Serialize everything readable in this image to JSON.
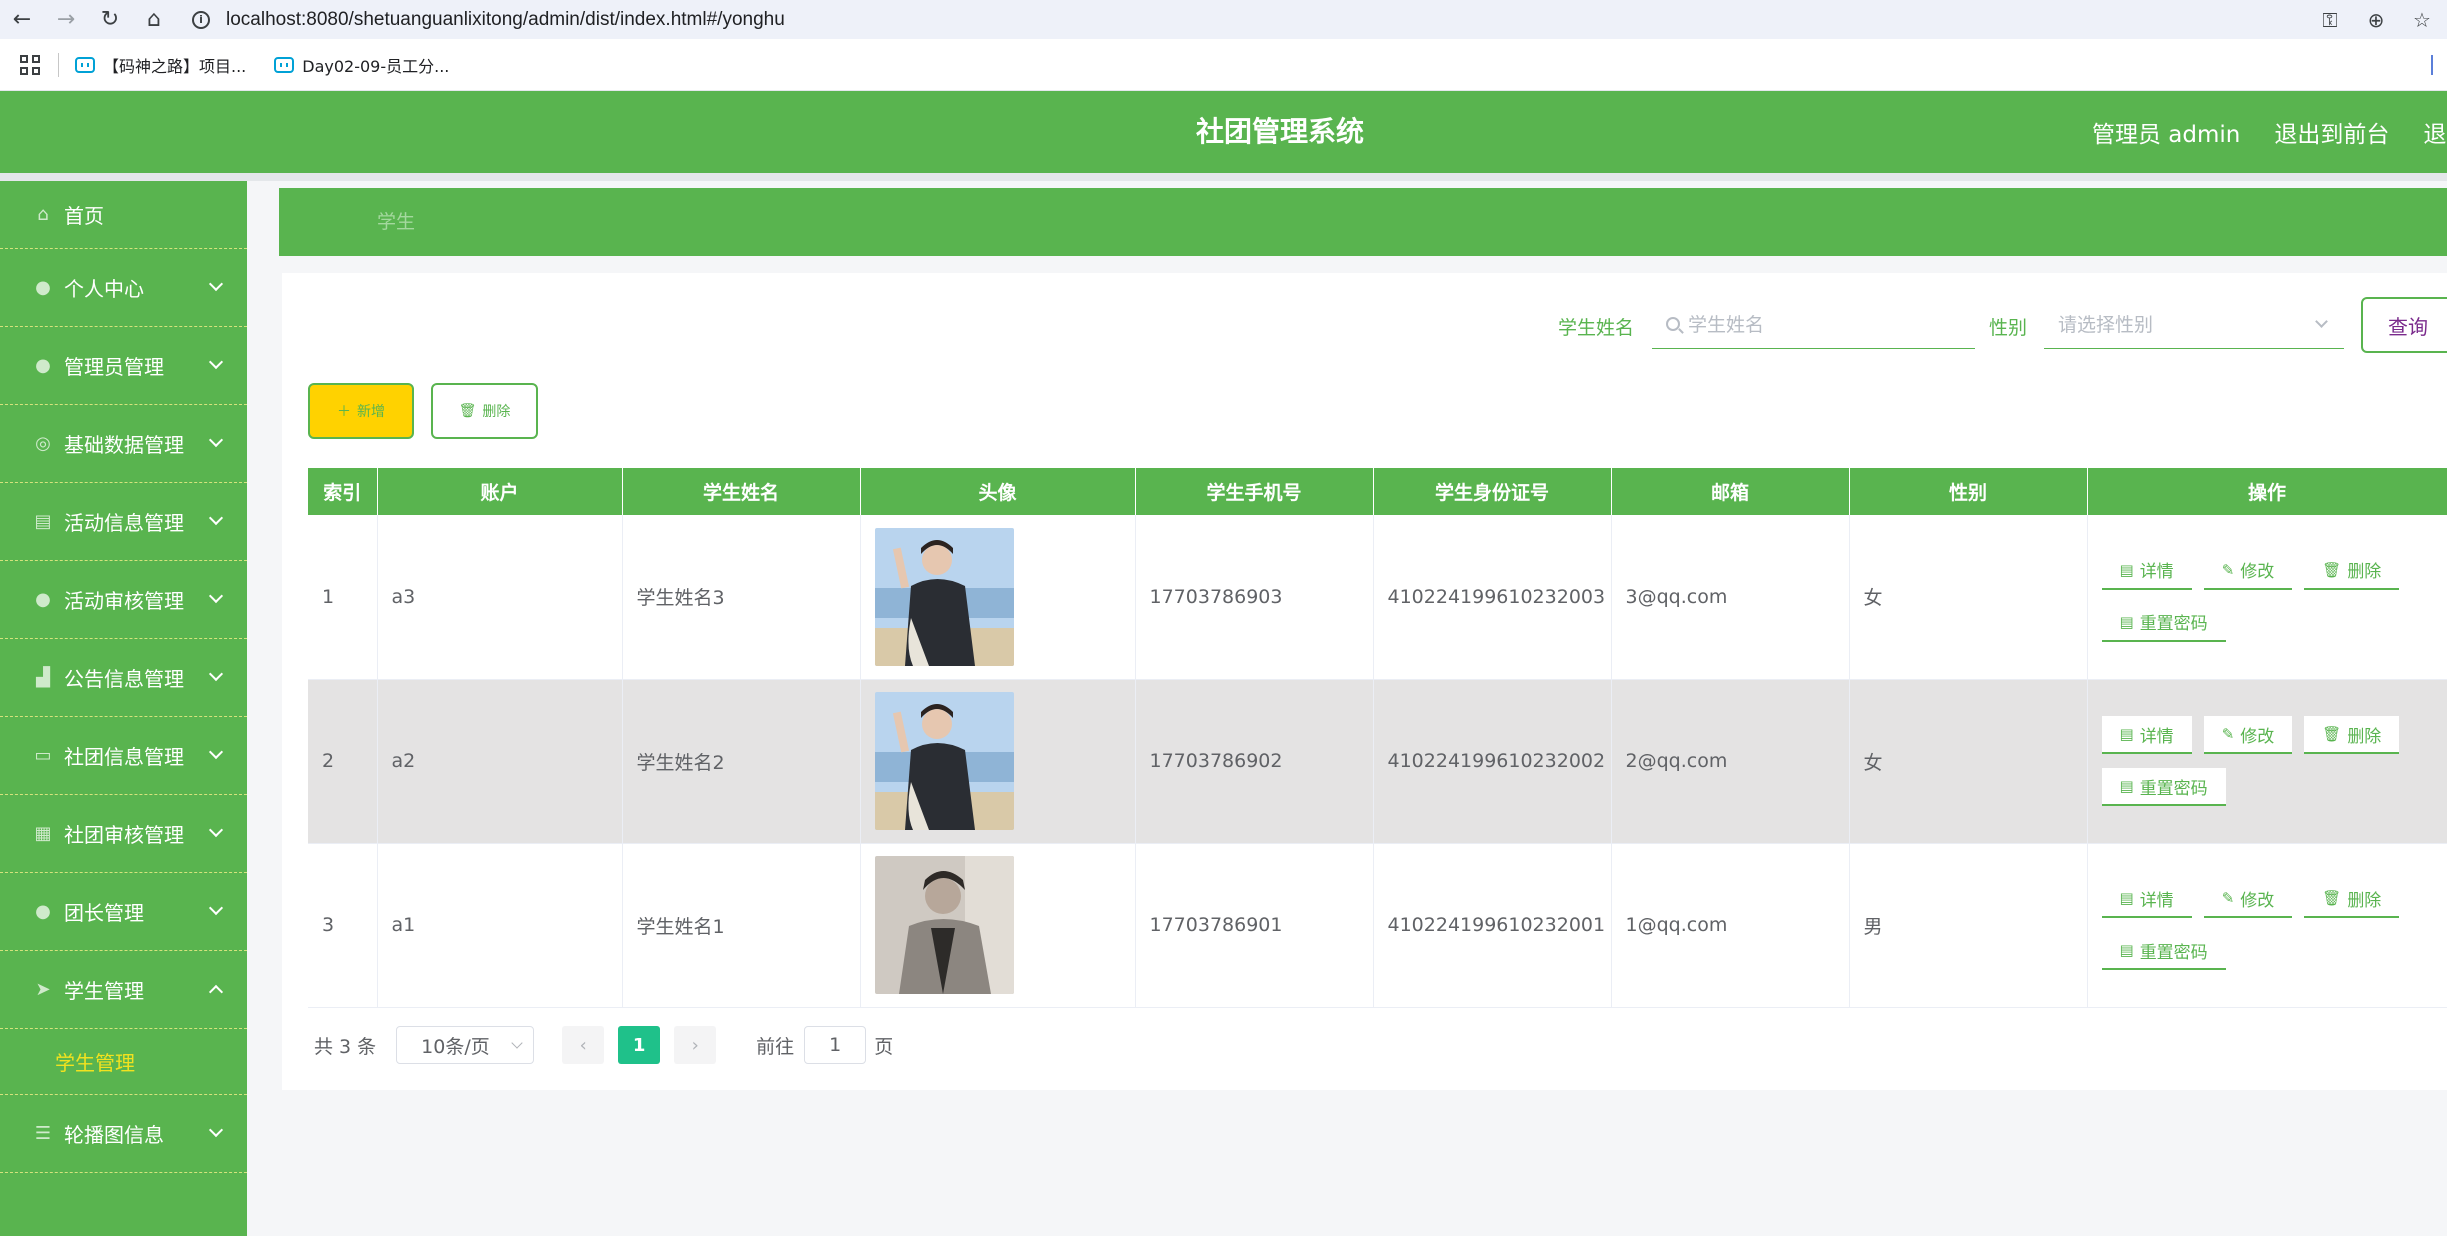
{
  "browser": {
    "url_host": "localhost",
    "url_rest": ":8080/shetuanguanlixitong/admin/dist/index.html#/yonghu",
    "bookmarks": [
      {
        "label": "【码神之路】项目..."
      },
      {
        "label": "Day02-09-员工分..."
      }
    ]
  },
  "header": {
    "title": "社团管理系统",
    "user": "管理员 admin",
    "to_front": "退出到前台",
    "logout": "退出"
  },
  "sidebar": {
    "items": [
      {
        "label": "首页",
        "icon": "home-icon"
      },
      {
        "label": "个人中心",
        "icon": "user-icon"
      },
      {
        "label": "管理员管理",
        "icon": "user-icon"
      },
      {
        "label": "基础数据管理",
        "icon": "data-icon"
      },
      {
        "label": "活动信息管理",
        "icon": "list-icon"
      },
      {
        "label": "活动审核管理",
        "icon": "user-icon"
      },
      {
        "label": "公告信息管理",
        "icon": "chart-icon"
      },
      {
        "label": "社团信息管理",
        "icon": "doc-icon"
      },
      {
        "label": "社团审核管理",
        "icon": "grid-icon"
      },
      {
        "label": "团长管理",
        "icon": "user-icon"
      },
      {
        "label": "学生管理",
        "icon": "send-icon"
      },
      {
        "label": "轮播图信息",
        "icon": "menu-icon"
      }
    ],
    "active_sub": "学生管理"
  },
  "breadcrumb": {
    "current": "学生"
  },
  "search": {
    "name_label": "学生姓名",
    "name_placeholder": "学生姓名",
    "gender_label": "性别",
    "gender_placeholder": "请选择性别",
    "query_label": "查询"
  },
  "toolbar": {
    "add_label": "新增",
    "delete_label": "删除"
  },
  "table": {
    "columns": [
      "索引",
      "账户",
      "学生姓名",
      "头像",
      "学生手机号",
      "学生身份证号",
      "邮箱",
      "性别",
      "操作"
    ],
    "rows": [
      {
        "index": "1",
        "account": "a3",
        "name": "学生姓名3",
        "phone": "17703786903",
        "id_card": "410224199610232003",
        "email": "3@qq.com",
        "gender": "女"
      },
      {
        "index": "2",
        "account": "a2",
        "name": "学生姓名2",
        "phone": "17703786902",
        "id_card": "410224199610232002",
        "email": "2@qq.com",
        "gender": "女"
      },
      {
        "index": "3",
        "account": "a1",
        "name": "学生姓名1",
        "phone": "17703786901",
        "id_card": "410224199610232001",
        "email": "1@qq.com",
        "gender": "男"
      }
    ],
    "ops": {
      "detail": "详情",
      "edit": "修改",
      "delete": "删除",
      "reset": "重置密码"
    }
  },
  "pagination": {
    "total": "共 3 条",
    "page_size": "10条/页",
    "current_page": "1",
    "goto_label": "前往",
    "goto_value": "1",
    "page_suffix": "页"
  },
  "colors": {
    "primary": "#59b44f",
    "accent_yellow": "#ffd200",
    "page_active": "#1fc18a"
  }
}
